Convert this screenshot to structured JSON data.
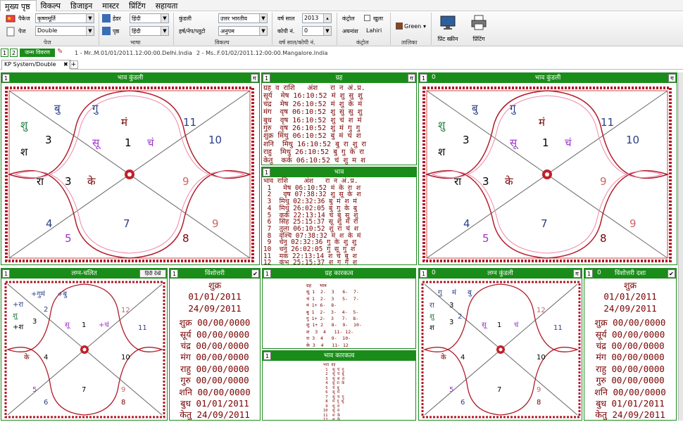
{
  "menu": {
    "items": [
      "मुख्य पृष्ठ",
      "विकल्प",
      "डिजाइन",
      "मास्टर",
      "प्रिंटिंग",
      "सहायता"
    ]
  },
  "ribbon": {
    "package_label": "पैकेज",
    "package_value": "कृष्णमूर्ति",
    "page_label": "पेज",
    "page_value": "Double",
    "header_label": "हेडर",
    "header_value": "हिंदी",
    "page2_label": "पृष्ठ",
    "page2_value": "हिंदी",
    "kundli_label": "कुंडली",
    "kundli_value": "उत्तर भारतीय",
    "horary_label": "हर्ष/नेप/प्लूटो",
    "horary_value": "अनुपम",
    "year_label": "वर्ष साल",
    "year_value": "2013",
    "copy_label": "कोपी नं.",
    "copy_value": "0",
    "control_label": "कंट्रोल",
    "open_label": "खुला",
    "ayanamsha_label": "अयनांश",
    "ayanamsha_value": "Lahiri",
    "color_value": "Green",
    "print_screen_label": "प्रिंट स्क्रीन",
    "printing_label": "प्रिंटिंग",
    "group_page": "पेज",
    "group_language": "भाषा",
    "group_option": "विकल्प",
    "group_year": "वर्ष साल/कोपी नं.",
    "group_control": "कंट्रोल",
    "group_table": "तालिका"
  },
  "infobar": {
    "n1": "1",
    "n2": "2",
    "birth_btn": "जन्म विवरण",
    "person1": "1 - Mr..M.01/01/2011.12:00:00.Delhi.India",
    "person2": "2 - Ms..F.01/02/2011.12:00:00.Mangalore.India"
  },
  "tabs": {
    "active": "KP System/Double",
    "close": "✖",
    "add": "+"
  },
  "panels": {
    "p1": {
      "num": "1",
      "title": "भाव कुंडली",
      "btn": "ग"
    },
    "p2": {
      "num": "1",
      "title": "ग्रह",
      "btn": "ग"
    },
    "p3": {
      "num": "1",
      "title": "भाव",
      "btn": ""
    },
    "p4": {
      "num": "1",
      "num2": "0",
      "title": "भाव कुंडली",
      "btn": "ग"
    },
    "p5": {
      "num": "1",
      "title": "लग्न-चलित",
      "btn": "हिंदी देखें"
    },
    "p6": {
      "num": "1",
      "title": "विंशोत्तरी",
      "btn": "✔"
    },
    "p7": {
      "num": "1",
      "title": "ग्रह कारकत्व",
      "btn": ""
    },
    "p8": {
      "num": "1",
      "title": "भाव कारकत्व",
      "btn": ""
    },
    "p9": {
      "num": "1",
      "num2": "0",
      "title": "लग्न कुंडली",
      "btn": "ग"
    },
    "p10": {
      "num": "1",
      "num2": "0",
      "title": "विंशोत्तरी दशा",
      "btn": "✔"
    }
  },
  "chart_big": {
    "labels": [
      "बु",
      "गु",
      "मं",
      "सू",
      "1",
      "चं",
      "11",
      "10",
      "शु",
      "3",
      "श",
      "रा",
      "3",
      "के",
      "9",
      "4",
      "7",
      "9",
      "5",
      "8"
    ]
  },
  "chart_small": {
    "labels": [
      "+गुमं",
      "+बु",
      "+रा",
      "2",
      "शु",
      "3",
      "+श",
      "सू",
      "1",
      "+चं",
      "12",
      "11",
      "के",
      "4",
      "10",
      "5",
      "7",
      "9",
      "6",
      "8"
    ]
  },
  "chart_small2": {
    "labels": [
      "गु",
      "मं",
      "बु",
      "रा",
      "3",
      "2",
      "शु",
      "3",
      "श",
      "सू",
      "1",
      "चं",
      "12",
      "11",
      "के",
      "4",
      "10",
      "5",
      "7",
      "9",
      "6",
      "8"
    ]
  },
  "graha_table": "ग्रह व राशि   अंश   रा न अं.प्र.\nसूर्य  मेष 16:10:52 मं शु सु शु\nचंद्र  मेष 26:10:52 मं शु के मं\nमंग  वृष 06:10:52 शु सु सु शु\nबुध  वृष 16:10:52 शु चं श मं\nगुरु  वृष 26:10:52 शु मं गु गु\nशुक्र मिथु 06:10:52 बु मं चं श\nशनि  मिथु 16:10:52 बु रा शु रा\nराहु  मिथु 26:10:52 बु गु के रा\nकेतु  कर्क 06:10:52 चं शु म श",
  "bhava_table": "भाव राशि    अंश   रा न अं.प्र.\n 1   मेष 06:10:52 मं के रा श\n 2   वृष 07:38:32 शु सू के श\n 3  मिथु 02:32:36 बु मं श मं\n 4  मिथु 26:02:05 बु गु के बु\n 5  कर्क 22:13:14 चं बु सू शु\n 6  सिंह 25:15:37 सू शु मं रा\n 7  तुला 06:10:52 शु रा चं श\n 8  वृश्चि 07:38:32 मं श के मं\n 9  धनु 02:32:36 गु के शु शु\n10  धनु 26:02:05 गु सू गु श\n11  मक 22:13:14 श चं बु श\n12  कुंभ 25:15:37 श गु गु श",
  "graha_karak": "ग्रह   भाव\nसू 1  2-  3   6-  7-\nचं 1  2-  3   5-  7-\nमं 1+ 6-  8-\nबु 1  2-  3-  4-  5-\nगु 1+ 2-  3   7-  8-\nशु 1+ 2   8-  9-  10-\nश  3  4   11- 12-\nरा 3  4   9-  10-\nके 3  4   11- 12",
  "bhava_karak": "भाव ग्रह\n 1  सू चं गु\n 2  सू चं बु\n 3  सू श रा\n 4  बु रा के\n 5  चं बु\n 6  सू मं\n 7  सू चं गु\n 8  मं गु शु\n 9  शु रा\n10  शु रा\n11  श के\n12  श के",
  "dasha": {
    "planet": "शुक्र",
    "start": "01/01/2011",
    "end": "24/09/2011",
    "rows": [
      "शुक्र 00/00/0000",
      "सूर्य 00/00/0000",
      "चंद्र 00/00/0000",
      "मंग 00/00/0000",
      "राहु 00/00/0000",
      "गुरु 00/00/0000",
      "शनि 00/00/0000",
      "बुध 01/01/2011",
      "केतु 24/09/2011"
    ]
  },
  "colors": {
    "green": "#1a8c1a",
    "maroon": "#7a0000",
    "border": "#b11b2b"
  }
}
